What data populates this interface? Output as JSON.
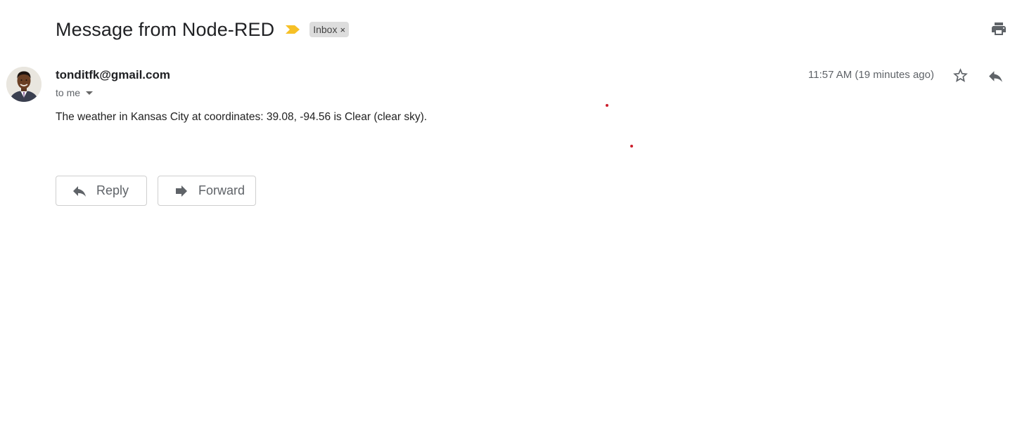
{
  "subject": "Message from Node-RED",
  "label": {
    "name": "Inbox",
    "remove_glyph": "×"
  },
  "colors": {
    "importance_marker": "#f6c026",
    "cursor_dot": "#cc1f2c",
    "chip_background": "#dddddd"
  },
  "icons": {
    "print": "print-icon",
    "star": "star-icon",
    "reply": "reply-icon",
    "forward": "forward-icon",
    "importance": "importance-marker-icon",
    "caret": "chevron-down-icon"
  },
  "message": {
    "sender": "tonditfk@gmail.com",
    "recipient": "to me",
    "timestamp": "11:57 AM (19 minutes ago)",
    "body": "The weather in Kansas City at coordinates: 39.08, -94.56 is Clear (clear sky)."
  },
  "actions": {
    "reply_label": "Reply",
    "forward_label": "Forward"
  }
}
